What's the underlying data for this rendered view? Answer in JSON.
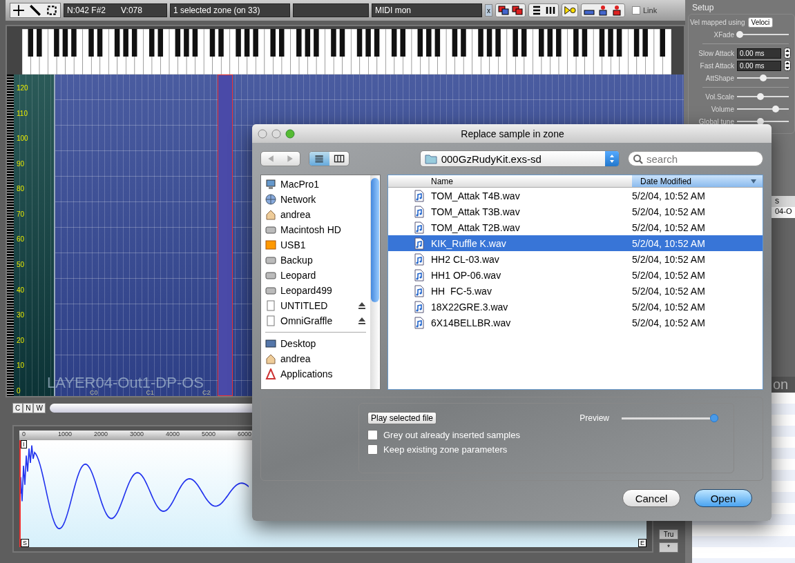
{
  "toolbar": {
    "note_field": "N:042 F#2",
    "velocity_field": "V:078",
    "selection_field": "1 selected zone (on 33)",
    "midi_field": "MIDI mon",
    "clear_label": "x",
    "link": {
      "label": "Link",
      "checked": false
    }
  },
  "zone_map": {
    "velocity_labels": [
      "120",
      "110",
      "100",
      "90",
      "80",
      "70",
      "60",
      "50",
      "40",
      "30",
      "20",
      "10",
      "0"
    ],
    "note_labels": [
      "C0",
      "C1",
      "C2"
    ],
    "layer_name": "LAYER04-Out1-DP-OS"
  },
  "view_buttons": [
    "C",
    "N",
    "W"
  ],
  "waveform": {
    "ruler_labels": [
      "0",
      "1000",
      "2000",
      "3000",
      "4000",
      "5000",
      "6000"
    ],
    "loop_marker": "I",
    "start_marker": "S",
    "end_marker": "E"
  },
  "side_buttons": [
    "Tru",
    "*"
  ],
  "setup": {
    "title": "Setup",
    "vel_label": "Vel mapped using",
    "vel_button": "Veloci",
    "rows": [
      {
        "kind": "slider",
        "label": "XFade",
        "level": 0.05
      },
      {
        "kind": "divider"
      },
      {
        "kind": "spin",
        "label": "Slow Attack",
        "value": "0.00 ms"
      },
      {
        "kind": "spin",
        "label": "Fast Attack",
        "value": "0.00 ms"
      },
      {
        "kind": "slider",
        "label": "AttShape",
        "level": 0.5
      },
      {
        "kind": "divider"
      },
      {
        "kind": "slider",
        "label": "Vol.Scale",
        "level": 0.45
      },
      {
        "kind": "slider",
        "label": "Volume",
        "level": 0.75
      },
      {
        "kind": "slider",
        "label": "Global tune",
        "level": 0.45
      }
    ]
  },
  "right_fragments": {
    "header": "s",
    "row": "04-O",
    "large": "on"
  },
  "dialog": {
    "title": "Replace sample in zone",
    "view_modes": [
      {
        "kind": "list",
        "selected": true
      },
      {
        "kind": "columns",
        "selected": false
      }
    ],
    "path": "000GzRudyKit.exs-sd",
    "search": {
      "placeholder": "search"
    },
    "sidebar": {
      "devices": [
        {
          "label": "MacPro1",
          "kind": "computer",
          "eject": false
        },
        {
          "label": "Network",
          "kind": "network",
          "eject": false
        },
        {
          "label": "andrea",
          "kind": "home",
          "eject": false
        },
        {
          "label": "Macintosh HD",
          "kind": "disk",
          "eject": false
        },
        {
          "label": "USB1",
          "kind": "usb",
          "eject": false
        },
        {
          "label": "Backup",
          "kind": "disk",
          "eject": false
        },
        {
          "label": "Leopard",
          "kind": "disk",
          "eject": false
        },
        {
          "label": "Leopard499",
          "kind": "disk",
          "eject": false
        },
        {
          "label": "UNTITLED",
          "kind": "blank",
          "eject": true
        },
        {
          "label": "OmniGraffle",
          "kind": "blank",
          "eject": true
        }
      ],
      "places": [
        {
          "label": "Desktop",
          "kind": "desktop",
          "eject": false
        },
        {
          "label": "andrea",
          "kind": "home",
          "eject": false
        },
        {
          "label": "Applications",
          "kind": "apps",
          "eject": false
        }
      ]
    },
    "columns": [
      {
        "label": "Name",
        "sorted": false
      },
      {
        "label": "Date Modified",
        "sorted": true
      }
    ],
    "files": [
      {
        "name": "TOM_Attak T4B.wav",
        "date": "5/2/04, 10:52 AM",
        "selected": false
      },
      {
        "name": "TOM_Attak T3B.wav",
        "date": "5/2/04, 10:52 AM",
        "selected": false
      },
      {
        "name": "TOM_Attak T2B.wav",
        "date": "5/2/04, 10:52 AM",
        "selected": false
      },
      {
        "name": "KIK_Ruffle K.wav",
        "date": "5/2/04, 10:52 AM",
        "selected": true
      },
      {
        "name": "HH2 CL-03.wav",
        "date": "5/2/04, 10:52 AM",
        "selected": false
      },
      {
        "name": "HH1 OP-06.wav",
        "date": "5/2/04, 10:52 AM",
        "selected": false
      },
      {
        "name": "HH  FC-5.wav",
        "date": "5/2/04, 10:52 AM",
        "selected": false
      },
      {
        "name": "18X22GRE.3.wav",
        "date": "5/2/04, 10:52 AM",
        "selected": false
      },
      {
        "name": "6X14BELLBR.wav",
        "date": "5/2/04, 10:52 AM",
        "selected": false
      }
    ],
    "play_button": "Play selected file",
    "preview": {
      "label": "Preview",
      "level": 1.0
    },
    "options": [
      {
        "label": "Grey out already inserted samples",
        "checked": false
      },
      {
        "label": "Keep existing zone parameters",
        "checked": false
      }
    ],
    "buttons": [
      {
        "label": "Cancel",
        "kind": "normal"
      },
      {
        "label": "Open",
        "kind": "default"
      }
    ]
  }
}
